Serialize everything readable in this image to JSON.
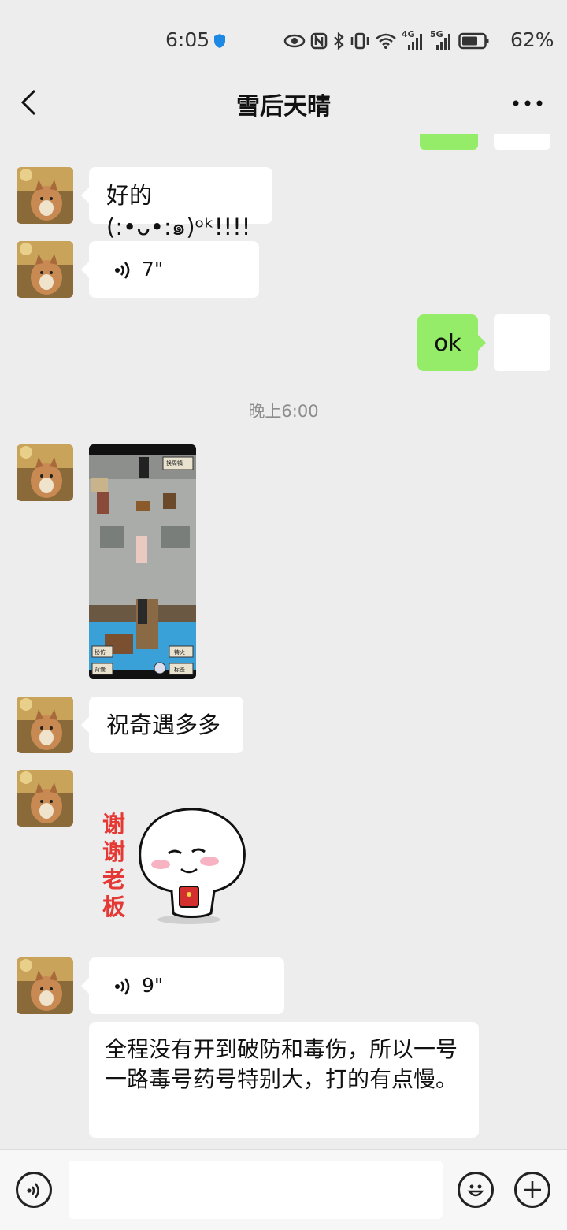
{
  "status_bar": {
    "time": "6:05",
    "battery_percent": "62%",
    "network_labels": [
      "4G",
      "5G"
    ]
  },
  "header": {
    "title": "雪后天晴"
  },
  "messages": {
    "m1_text": "好的(:•ᴗ•:๑)ᵒᵏ!!!!",
    "m2_voice_duration": "7\"",
    "m3_text": "ok",
    "timestamp": "晚上6:00",
    "m5_text": "祝奇遇多多",
    "m6_sticker_text": "谢谢老板",
    "m7_voice_duration": "9\"",
    "m8_text": "全程没有开到破防和毒伤，所以一号一路毒号药号特别大，打的有点慢。"
  },
  "game_screenshot": {
    "top_right_button": "换周镇",
    "btn_left_1": "秘仿",
    "btn_left_2": "背囊",
    "btn_right_1": "铸火",
    "btn_right_2": "标签"
  },
  "colors": {
    "bubble_sent": "#95ec69",
    "background": "#ededed",
    "sticker_text": "#e53935"
  }
}
